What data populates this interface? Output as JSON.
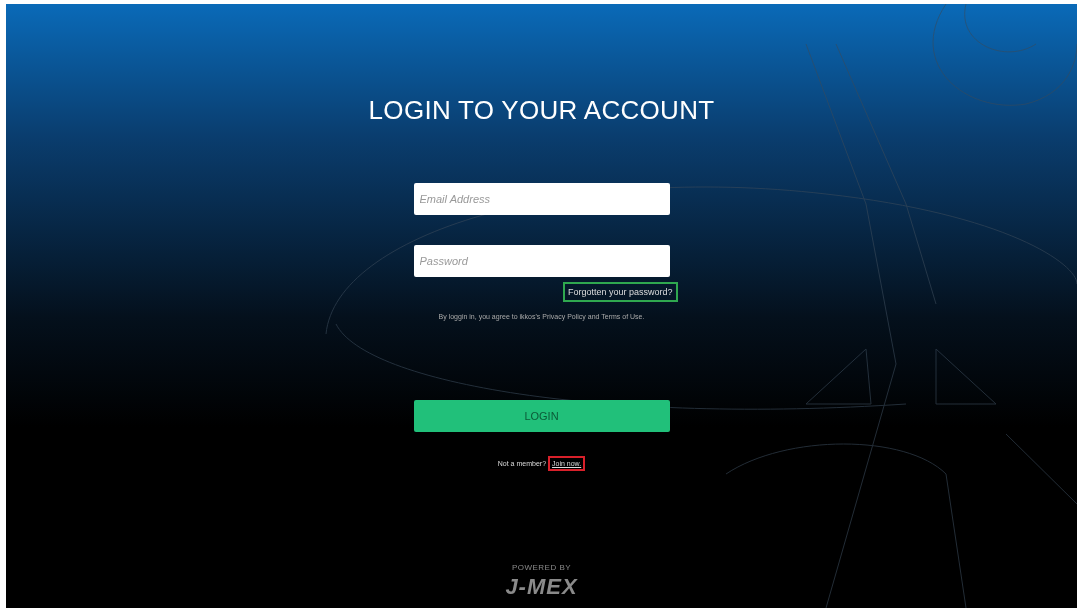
{
  "title": "LOGIN TO YOUR ACCOUNT",
  "fields": [
    {
      "placeholder": "Email Address"
    },
    {
      "placeholder": "Password"
    }
  ],
  "forgot_link": {
    "label": "Forgotten your password?",
    "color": "#2fa84f"
  },
  "consent": "By loggin in, you agree to ikkos's Privacy Policy and Terms of Use.",
  "login_button": "LOGIN",
  "join": {
    "prompt": "Not a member?",
    "link": {
      "label": "Join now.",
      "color": "#d8202a"
    }
  },
  "footer": {
    "powered_by": "POWERED BY",
    "logo": "J-MEX"
  }
}
